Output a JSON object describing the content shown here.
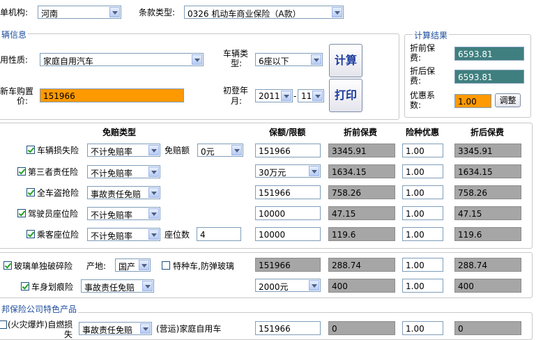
{
  "top": {
    "org_label": "单机构:",
    "org_value": "河南",
    "clause_label": "条款类型:",
    "clause_value": "0326 机动车商业保险（A款）"
  },
  "vehicle": {
    "section_title": "辆信息",
    "use_label": "用性质:",
    "use_value": "家庭自用汽车",
    "type_label_1": "车辆类",
    "type_label_2": "型:",
    "type_value": "6座以下",
    "price_label_1": "新车购置",
    "price_label_2": "价:",
    "price_value": "151966",
    "reg_label_1": "初登年",
    "reg_label_2": "月:",
    "reg_year": "2011",
    "reg_sep": "-",
    "reg_month": "11",
    "calc_button": "计算",
    "print_button": "打印"
  },
  "result": {
    "title": "计算结果",
    "before_label_1": "折前保",
    "before_label_2": "费:",
    "before_value": "6593.81",
    "after_label_1": "折后保",
    "after_label_2": "费:",
    "after_value": "6593.81",
    "discount_label_1": "优惠系",
    "discount_label_2": "数:",
    "discount_value": "1.00",
    "adjust_button": "调整"
  },
  "table": {
    "headers": [
      "免赔类型",
      "保额/限额",
      "折前保费",
      "险种优惠",
      "折后保费"
    ],
    "deductible_label": "免赔额",
    "deductible_value": "0元",
    "seats_label": "座位数",
    "seats_value": "4",
    "rows": [
      {
        "name": "车辆损失险",
        "type": "不计免赔率",
        "amount": "151966",
        "before": "3345.91",
        "discount": "1.00",
        "after": "3345.91",
        "checked": true
      },
      {
        "name": "第三者责任险",
        "type": "不计免赔率",
        "amount": "30万元",
        "before": "1634.15",
        "discount": "1.00",
        "after": "1634.15",
        "checked": true
      },
      {
        "name": "全车盗抢险",
        "type": "事故责任免赔",
        "amount": "151966",
        "before": "758.26",
        "discount": "1.00",
        "after": "758.26",
        "checked": true
      },
      {
        "name": "驾驶员座位险",
        "type": "不计免赔率",
        "amount": "10000",
        "before": "47.15",
        "discount": "1.00",
        "after": "47.15",
        "checked": true
      },
      {
        "name": "乘客座位险",
        "type": "不计免赔率",
        "amount": "10000",
        "before": "119.6",
        "discount": "1.00",
        "after": "119.6",
        "checked": true
      }
    ]
  },
  "extra": {
    "glass_name": "玻璃单独破碎险",
    "origin_label": "产地:",
    "origin_value": "国产",
    "special_label": "特种车,防弹玻璃",
    "glass_amount": "151966",
    "glass_before": "288.74",
    "glass_discount": "1.00",
    "glass_after": "288.74",
    "scratch_name": "车身划痕险",
    "scratch_type": "事故责任免赔",
    "scratch_amount": "2000元",
    "scratch_before": "400",
    "scratch_discount": "1.00",
    "scratch_after": "400"
  },
  "special": {
    "section_title": "邦保险公司特色产品",
    "fire_label_1": "(火灾爆炸)自燃损",
    "fire_label_2": "失",
    "fire_type": "事故责任免赔",
    "fire_use_label": "(营运)家庭自用车",
    "fire_amount": "151966",
    "fire_before": "0",
    "fire_discount": "1.00",
    "fire_after": "0"
  }
}
